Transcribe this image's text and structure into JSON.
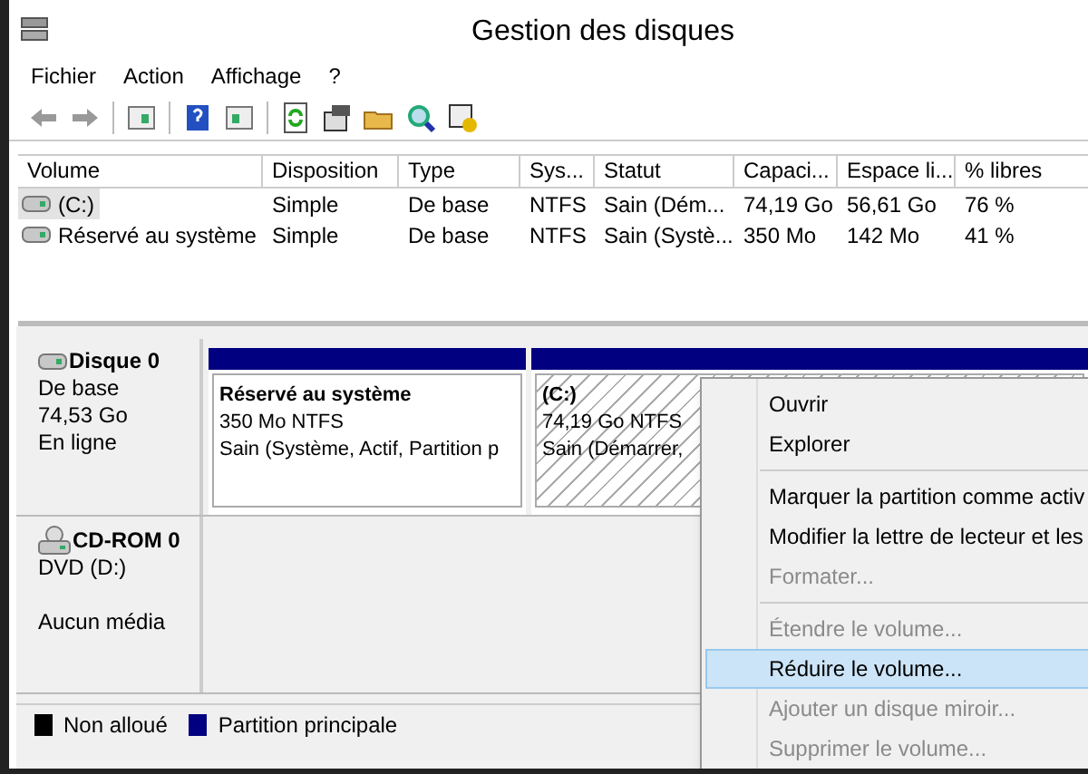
{
  "window": {
    "title": "Gestion des disques"
  },
  "menu": [
    "Fichier",
    "Action",
    "Affichage",
    "?"
  ],
  "volumes": {
    "columns": [
      "Volume",
      "Disposition",
      "Type",
      "Sys...",
      "Statut",
      "Capaci...",
      "Espace li...",
      "% libres"
    ],
    "rows": [
      {
        "selected": true,
        "cells": [
          "(C:)",
          "Simple",
          "De base",
          "NTFS",
          "Sain (Dém...",
          "74,19 Go",
          "56,61 Go",
          "76 %"
        ]
      },
      {
        "selected": false,
        "cells": [
          "Réservé au système",
          "Simple",
          "De base",
          "NTFS",
          "Sain (Systè...",
          "350 Mo",
          "142 Mo",
          "41 %"
        ]
      }
    ]
  },
  "disks": [
    {
      "kind": "disk",
      "name": "Disque 0",
      "lines": [
        "De base",
        "74,53 Go",
        "En ligne"
      ],
      "partitions": [
        {
          "name": "Réservé au système",
          "lines": [
            "350 Mo NTFS",
            "Sain (Système, Actif, Partition p"
          ],
          "selected": false
        },
        {
          "name": "(C:)",
          "lines": [
            "74,19 Go NTFS",
            "Sain (Démarrer,"
          ],
          "selected": true
        }
      ]
    },
    {
      "kind": "cdrom",
      "name": "CD-ROM 0",
      "lines": [
        "DVD (D:)"
      ],
      "media": "Aucun média"
    }
  ],
  "legend": [
    {
      "label": "Non alloué",
      "color": "#000000"
    },
    {
      "label": "Partition principale",
      "color": "#000080"
    }
  ],
  "context_menu": [
    {
      "kind": "item",
      "label": "Ouvrir",
      "disabled": false,
      "selected": false
    },
    {
      "kind": "item",
      "label": "Explorer",
      "disabled": false,
      "selected": false
    },
    {
      "kind": "separator"
    },
    {
      "kind": "item",
      "label": "Marquer la partition comme activ",
      "disabled": false,
      "selected": false
    },
    {
      "kind": "item",
      "label": "Modifier la lettre de lecteur et les",
      "disabled": false,
      "selected": false
    },
    {
      "kind": "item",
      "label": "Formater...",
      "disabled": true,
      "selected": false
    },
    {
      "kind": "separator"
    },
    {
      "kind": "item",
      "label": "Étendre le volume...",
      "disabled": true,
      "selected": false
    },
    {
      "kind": "item",
      "label": "Réduire le volume...",
      "disabled": false,
      "selected": true
    },
    {
      "kind": "item",
      "label": "Ajouter un disque miroir...",
      "disabled": true,
      "selected": false
    },
    {
      "kind": "item",
      "label": "Supprimer le volume...",
      "disabled": true,
      "selected": false
    }
  ]
}
